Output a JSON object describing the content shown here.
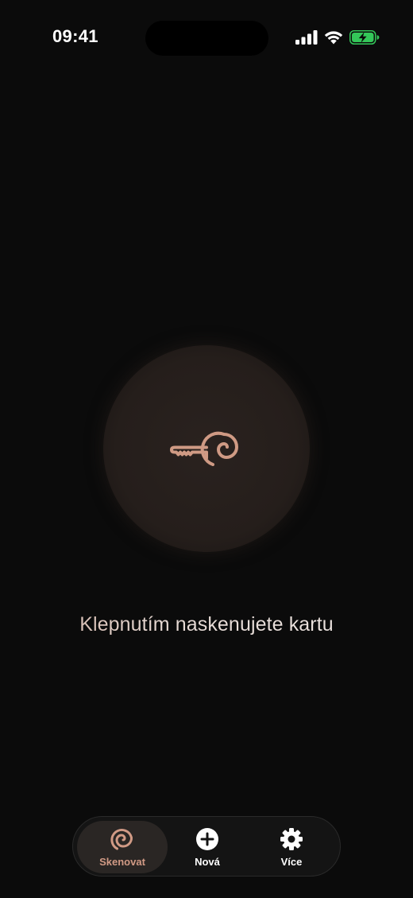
{
  "status_bar": {
    "time": "09:41"
  },
  "main": {
    "hint": "Klepnutím naskenujete kartu"
  },
  "tabs": [
    {
      "label": "Skenovat",
      "icon": "spiral-icon",
      "active": true
    },
    {
      "label": "Nová",
      "icon": "plus-circle-icon",
      "active": false
    },
    {
      "label": "Více",
      "icon": "gear-icon",
      "active": false
    }
  ],
  "colors": {
    "accent": "#d19a85",
    "background": "#0b0b0b",
    "battery": "#34c759"
  }
}
